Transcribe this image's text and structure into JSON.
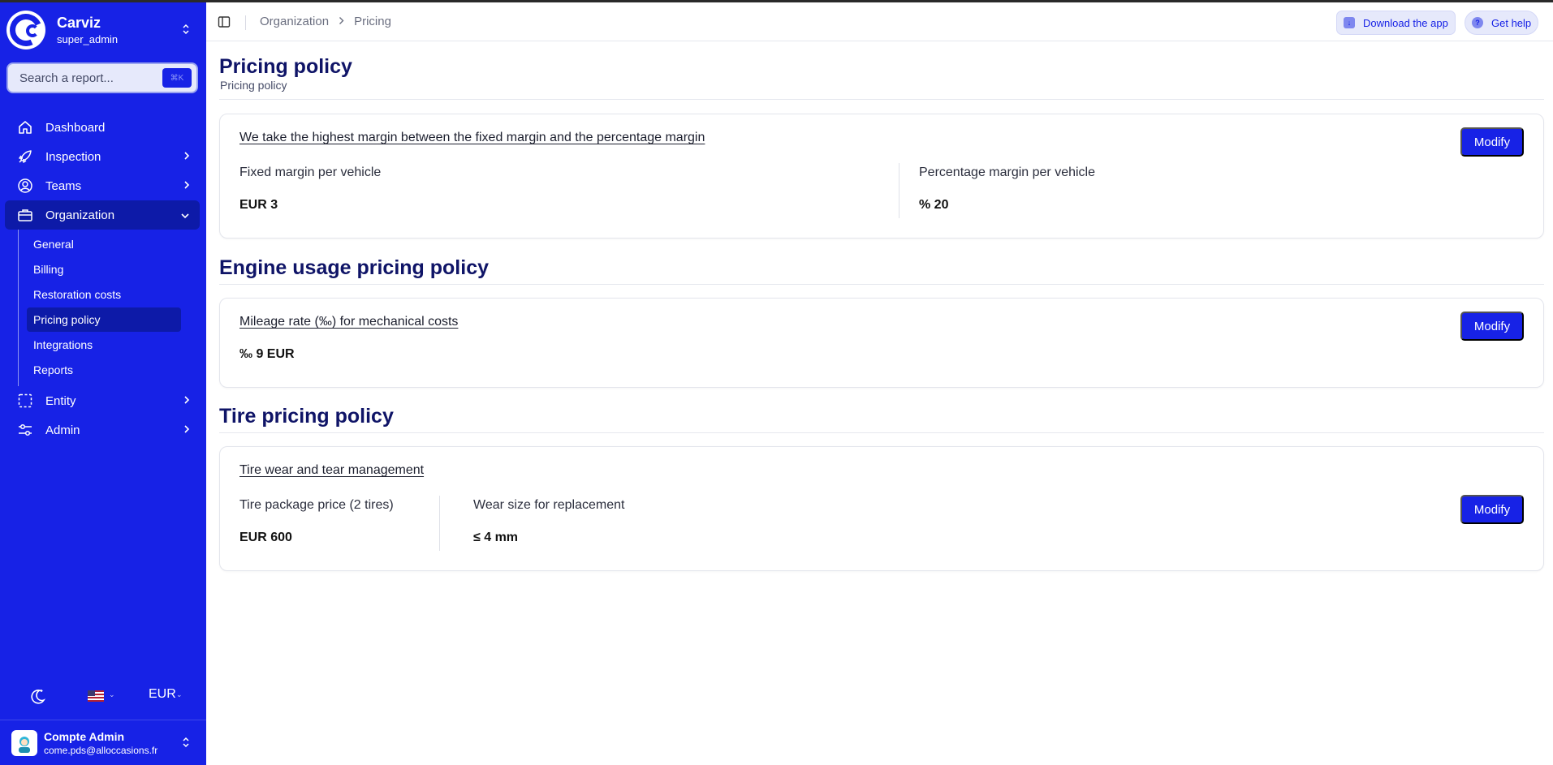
{
  "sidebar": {
    "brand": {
      "name": "Carviz",
      "role": "super_admin"
    },
    "search": {
      "placeholder": "Search a report...",
      "shortcut": "⌘K"
    },
    "nav": {
      "dashboard": "Dashboard",
      "inspection": "Inspection",
      "teams": "Teams",
      "organization": "Organization",
      "sub": [
        "General",
        "Billing",
        "Restoration costs",
        "Pricing policy",
        "Integrations",
        "Reports"
      ],
      "entity": "Entity",
      "admin": "Admin"
    },
    "footer": {
      "currency": "EUR"
    },
    "user": {
      "name": "Compte Admin",
      "email": "come.pds@alloccasions.fr"
    }
  },
  "topbar": {
    "breadcrumb": [
      "Organization",
      "Pricing"
    ],
    "download_label": "Download the app",
    "help_label": "Get help"
  },
  "main": {
    "title": "Pricing policy",
    "subtitle": "Pricing policy",
    "margin_card": {
      "title": "We take the highest margin between the fixed margin and the percentage margin",
      "fixed_label": "Fixed margin per vehicle",
      "fixed_value": "EUR  3",
      "percent_label": "Percentage margin per vehicle",
      "percent_value": "%  20",
      "button": "Modify"
    },
    "engine_heading": "Engine usage pricing policy",
    "engine_card": {
      "title": "Mileage rate (‰) for mechanical costs",
      "value": "‰  9 EUR",
      "button": "Modify"
    },
    "tire_heading": "Tire pricing policy",
    "tire_card": {
      "title": "Tire wear and tear management",
      "package_label": "Tire package price (2 tires)",
      "package_value": "EUR  600",
      "wear_label": "Wear size for replacement",
      "wear_value": "≤ 4 mm",
      "button": "Modify"
    }
  },
  "colors": {
    "accent": "#1722e6",
    "heading": "#0f1467",
    "active_nav": "#0d1aa8"
  }
}
